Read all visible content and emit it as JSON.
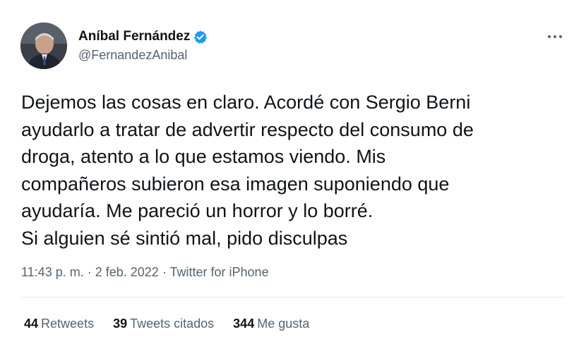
{
  "author": {
    "display_name": "Aníbal Fernández",
    "handle": "@FernandezAnibal",
    "verified": true
  },
  "tweet": {
    "text": "Dejemos las cosas en claro. Acordé con Sergio Berni\nayudarlo a tratar de advertir respecto del consumo de\ndroga, atento a lo que estamos viendo. Mis\ncompañeros subieron esa imagen suponiendo que\nayudaría. Me pareció un horror y lo borré.\nSi alguien sé sintió mal, pido disculpas",
    "time": "11:43 p. m.",
    "date": "2 feb. 2022",
    "source": "Twitter for iPhone",
    "separator": "·"
  },
  "stats": {
    "retweets_count": "44",
    "retweets_label": "Retweets",
    "quotes_count": "39",
    "quotes_label": "Tweets citados",
    "likes_count": "344",
    "likes_label": "Me gusta"
  },
  "icons": {
    "verified": "verified-badge-icon",
    "more": "more-options-icon"
  },
  "colors": {
    "verified_blue": "#1d9bf0",
    "text_primary": "#0f1419",
    "text_secondary": "#536471"
  }
}
